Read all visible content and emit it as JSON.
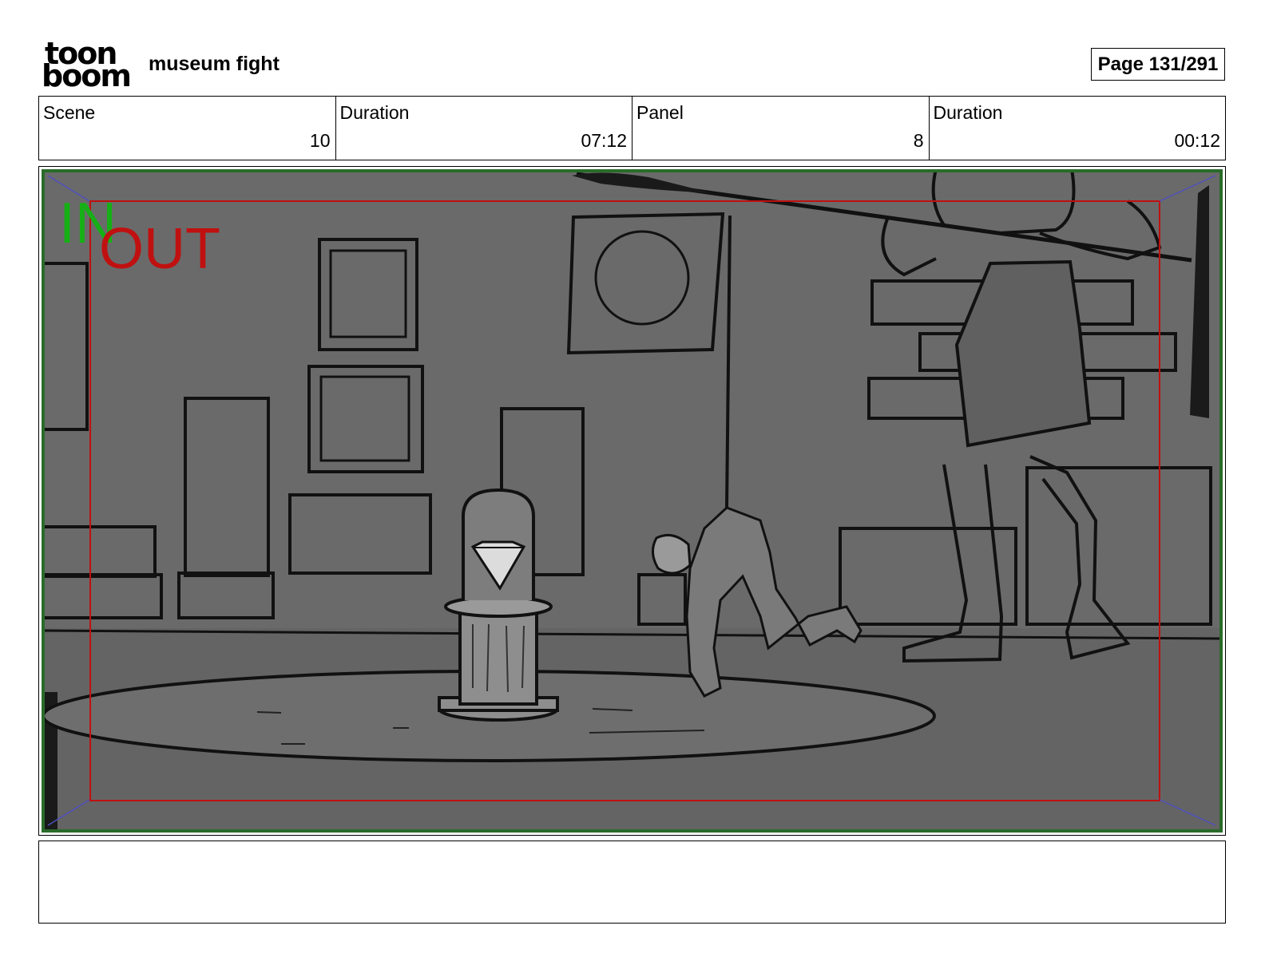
{
  "header": {
    "logo_text_top": "toon",
    "logo_text_bottom": "boom",
    "project_title": "museum fight",
    "page_label": "Page 131/291"
  },
  "info": {
    "scene_label": "Scene",
    "scene_value": "10",
    "scene_duration_label": "Duration",
    "scene_duration_value": "07:12",
    "panel_label": "Panel",
    "panel_value": "8",
    "panel_duration_label": "Duration",
    "panel_duration_value": "00:12"
  },
  "panel_overlay": {
    "in_label": "IN",
    "out_label": "OUT",
    "in_color": "#16b016",
    "out_color": "#c01010"
  },
  "notes": {
    "text": ""
  }
}
